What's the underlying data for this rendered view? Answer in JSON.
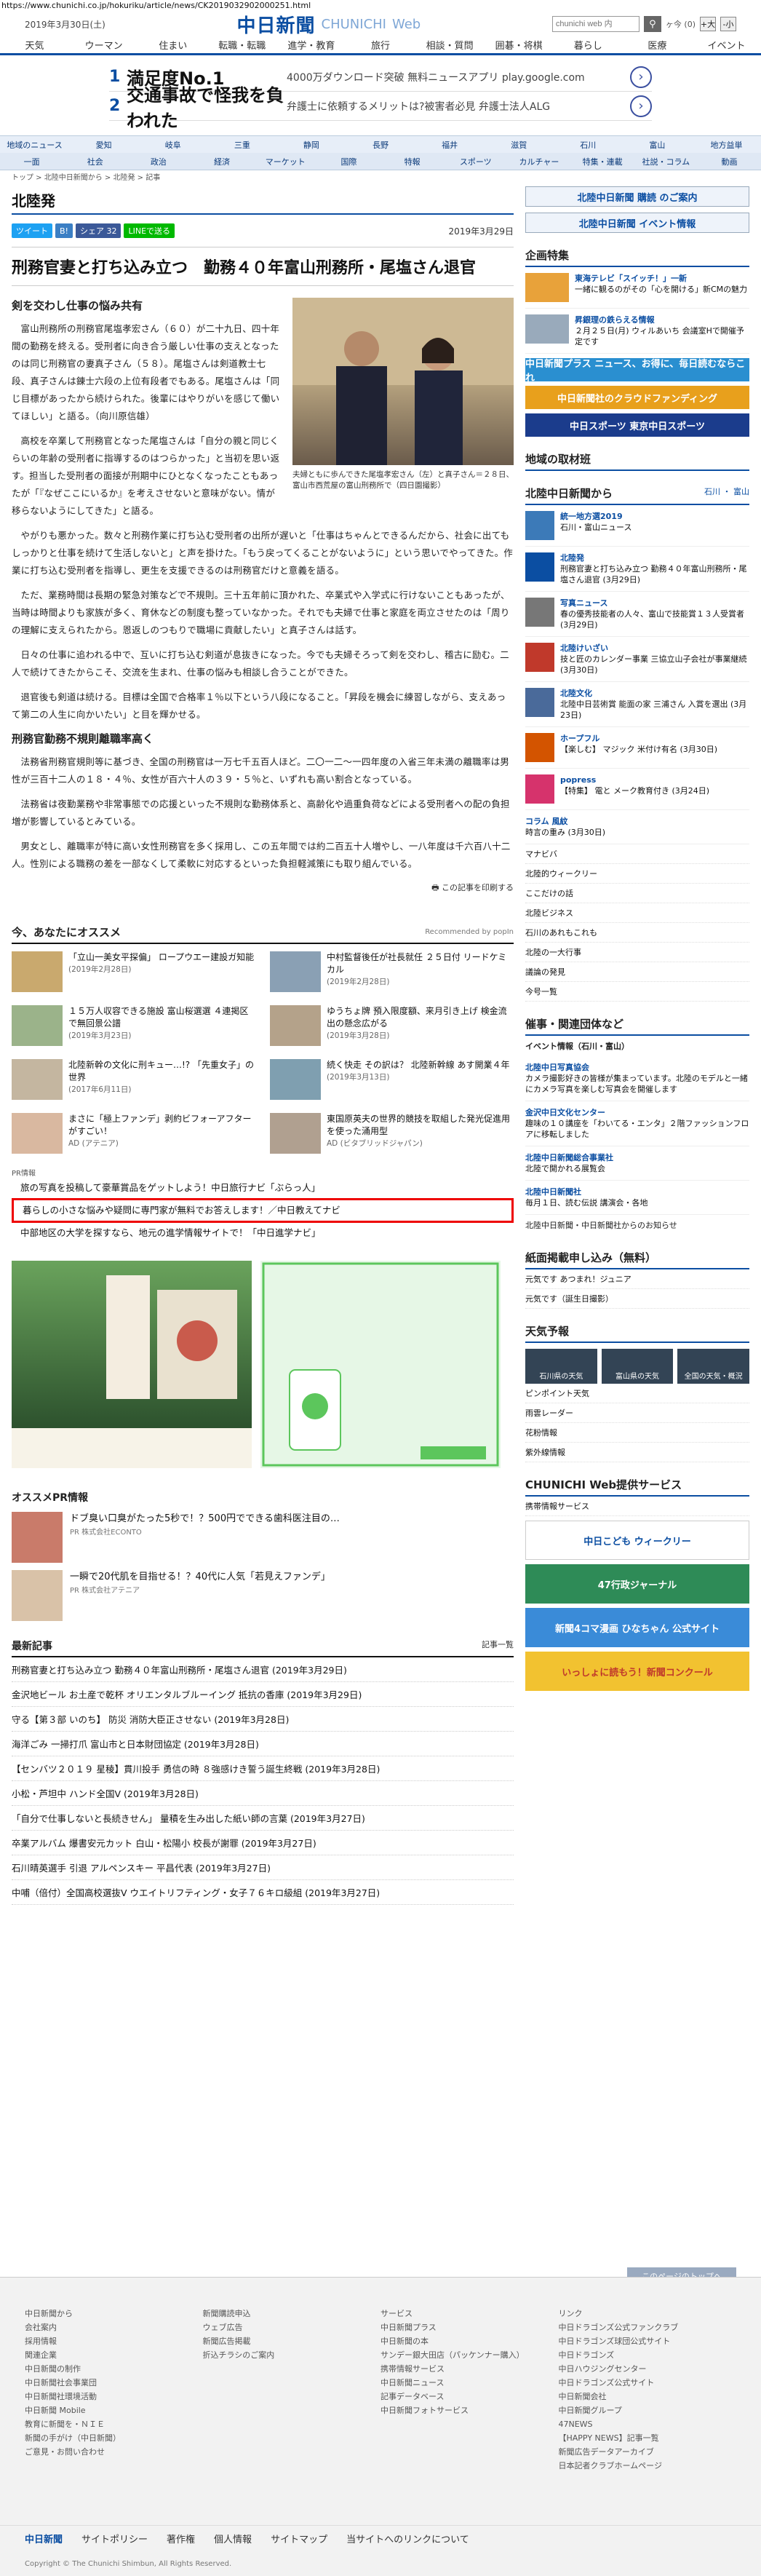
{
  "browser": {
    "url": "https://www.chunichi.co.jp/hokuriku/article/news/CK2019032902000251.html"
  },
  "header": {
    "date": "2019年3月30日(土)",
    "logo_jp": "中日新聞",
    "logo_en": "CHUNICHI",
    "logo_web": "Web",
    "search_placeholder": "chunichi web 内",
    "counter": "ヶ今 (0)",
    "font_large": "+大",
    "font_small": "-小"
  },
  "nav": [
    "天気",
    "ウーマン",
    "住まい",
    "転職・転職",
    "進学・教育",
    "旅行",
    "相談・質問",
    "囲碁・将棋",
    "暮らし",
    "医療",
    "イベント"
  ],
  "ad": {
    "items": [
      {
        "num": "1",
        "title": "満足度No.1",
        "sub": "4000万ダウンロード突破 無料ニュースアプリ play.google.com"
      },
      {
        "num": "2",
        "title": "交通事故で怪我を負われた",
        "sub": "弁護士に依頼するメリットは?被害者必見 弁護士法人ALG"
      }
    ]
  },
  "area_nav": [
    "地域のニュース",
    "愛知",
    "岐阜",
    "三重",
    "静岡",
    "長野",
    "福井",
    "滋賀",
    "石川",
    "富山",
    "地方益単"
  ],
  "area_nav2": [
    "一面",
    "社会",
    "政治",
    "経済",
    "マーケット",
    "国際",
    "特報",
    "スポーツ",
    "カルチャー",
    "特集・連載",
    "社説・コラム",
    "動画"
  ],
  "breadcrumb": "トップ > 北陸中日新聞から > 北陸発 > 記事",
  "section": "北陸発",
  "share": {
    "tweet": "ツイート",
    "hatena": "B!",
    "share": "シェア 32",
    "line": "LINEで送る",
    "date": "2019年3月29日"
  },
  "article": {
    "headline": "刑務官妻と打ち込み立つ　勤務４０年富山刑務所・尾塩さん退官",
    "h1": "剣を交わし仕事の悩み共有",
    "caption": "夫婦ともに歩んできた尾塩孝宏さん（左）と真子さん＝２８日、富山市西荒屋の富山刑務所で（四日園撮影）",
    "paragraphs": [
      "富山刑務所の刑務官尾塩孝宏さん（６０）が二十九日、四十年間の勤務を終える。受刑者に向き合う厳しい仕事の支えとなったのは同じ刑務官の妻真子さん（５８）。尾塩さんは剣道教士七段、真子さんは錬士六段の上位有段者でもある。尾塩さんは「同じ目標があったから続けられた。後輩にはやりがいを感じて働いてほしい」と語る。（向川原信雄）",
      "高校を卒業して刑務官となった尾塩さんは「自分の親と同じくらいの年齢の受刑者に指導するのはつらかった」と当初を思い返す。担当した受刑者の面接が刑期中にひとなくなったこともあったが「『なぜここにいるか』を考えさせないと意味がない。情が移らないようにしてきた」と語る。",
      "やがりも悪かった。数々と刑務作業に打ち込む受刑者の出所が遅いと「仕事はちゃんとできるんだから、社会に出てもしっかりと仕事を続けて生活しないと」と声を掛けた。「もう戻ってくることがないように」という思いでやってきた。作業に打ち込む受刑者を指導し、更生を支援できるのは刑務官だけと意義を語る。",
      "ただ、業務時間は長期の緊急対策などで不規則。三十五年前に頂かれた、卒業式や入学式に行けないこともあったが、当時は時間よりも家族が多く、育休などの制度も整っていなかった。それでも夫婦で仕事と家庭を両立させたのは「周りの理解に支えられたから。恩返しのつもりで職場に貢献したい」と真子さんは話す。",
      "日々の仕事に追われる中で、互いに打ち込む剣道が息抜きになった。今でも夫婦そろって剣を交わし、稽古に励む。二人で続けてきたからこそ、交流を生まれ、仕事の悩みも相談し合うことができた。",
      "退官後も剣道は続ける。目標は全国で合格率１％以下という八段になること。「昇段を機会に練習しながら、支えあって第二の人生に向かいたい」と目を輝かせる。"
    ],
    "h2": "刑務官勤務不規則離職率高く",
    "paragraphs2": [
      "法務省刑務官規則等に基づき、全国の刑務官は一万七千五百人ほど。二〇一二〜一四年度の入省三年未満の離職率は男性が三百十二人の１８・４％、女性が百六十人の３９・５％と、いずれも高い割合となっている。",
      "法務省は夜勤業務や非常事態での応援といった不規則な勤務体系と、高齢化や過重負荷などによる受刑者への配の負担増が影響しているとみている。",
      "男女とし、離職率が特に高い女性刑務官を多く採用し、この五年間では約二百五十人増やし、一八年度は千六百八十二人。性別による職務の差を一部なくして柔軟に対応するといった負担軽減策にも取り組んでいる。"
    ],
    "print": "この記事を印刷する"
  },
  "recommend": {
    "title": "今、あなたにオススメ",
    "by": "Recommended by popIn",
    "items": [
      {
        "title": "「立山一美女平探偏」 ロープウエー建設ガ知能",
        "date": "(2019年2月28日)"
      },
      {
        "title": "中村監督後任が社長就任 ２５日付 リードケミカル",
        "date": "(2019年2月28日)"
      },
      {
        "title": "１５万人収容できる施設 富山桜選選 ４連掲区で無回景公譜",
        "date": "(2019年3月23日)"
      },
      {
        "title": "ゆうちょ牌 預入限度額、来月引き上げ 検金流出の懸念広がる",
        "date": "(2019年3月28日)"
      },
      {
        "title": "北陸新幹の文化に刑キュー…!? 「先重女子」の世界",
        "date": "(2017年6月11日)"
      },
      {
        "title": "続く快走 その訳は？ 北陸新幹線 あす開業４年",
        "date": "(2019年3月13日)"
      },
      {
        "title": "まさに「極上ファンデ」剥約ビフォーアフターがすごい！",
        "date": "AD (アテニア)"
      },
      {
        "title": "東国原英夫の世界的競技を取組した発光促進用を使った涌用型",
        "date": "AD (ビタブリッドジャパン)"
      }
    ]
  },
  "pr": {
    "label": "PR情報",
    "lines": [
      "旅の写真を投稿して豪華賞品をゲットしよう！中日旅行ナビ「ぶらっ人」",
      "暮らしの小さな悩みや疑問に専門家が無料でお答えします！／中日教えてナビ",
      "中部地区の大学を探すなら、地元の進学情報サイトで！「中日進学ナビ」"
    ]
  },
  "osusume": {
    "title": "オススメPR情報",
    "items": [
      {
        "title": "ドブ臭い口臭がたった5秒で！？500円でできる歯科医注目の…",
        "src": "PR 株式会社ECONTO"
      },
      {
        "title": "一瞬で20代肌を目指せる！？40代に人気「若見えファンデ」",
        "src": "PR 株式会社アテニア"
      }
    ]
  },
  "latest": {
    "title": "最新記事",
    "more": "記事一覧",
    "items": [
      "刑務官妻と打ち込み立つ 勤務４０年富山刑務所・尾塩さん退官 (2019年3月29日)",
      "金沢地ビール お土産で乾杯 オリエンタルブルーイング 抵抗の香庫 (2019年3月29日)",
      "守る【第３部 いのち】 防災 消防大臣正させない (2019年3月28日)",
      "海洋ごみ 一掃打爪 富山市と日本財団協定 (2019年3月28日)",
      "【センバツ２０１９ 星稜】貫川投手 勇信の時 ８強感けき誓う誕生終戦 (2019年3月28日)",
      "小松・芦坦中 ハンド全国V (2019年3月28日)",
      "「自分で仕事しないと長続きせん」 量積を生み出した紙い師の言葉 (2019年3月27日)",
      "卒業アルバム 爆書安元カット 白山・松陽小 校長が謝罪 (2019年3月27日)",
      "石川晴英選手 引退 アルペンスキー 平昌代表 (2019年3月27日)",
      "中哺（倍付）全国高校選抜V ウエイトリフティング・女子７６キロ級組 (2019年3月27日)"
    ]
  },
  "sidebar": {
    "subscribe": "北陸中日新聞 購読 のご案内",
    "event": "北陸中日新聞 イベント情報",
    "kikaku": "企画特集",
    "kikaku_items": [
      {
        "title": "東海テレビ「スイッチ！」一新",
        "desc": "一緒に観るのがその「心を開ける」新CMの魅力"
      },
      {
        "title": "昇銀理の鉄らえる情報",
        "desc": "２月２５日(月) ウィルあいち 会議室Hで開催予定です"
      }
    ],
    "banners": [
      "中日新聞プラス ニュース、お得に、毎日読むならこれ",
      "中日新聞社のクラウドファンディング",
      "中日スポーツ 東京中日スポーツ"
    ],
    "chiiki": "地域の取材班",
    "kara": "北陸中日新聞から",
    "kara_loc": "石川 ・ 富山",
    "kara_items": [
      {
        "title": "統一地方選2019",
        "desc": "石川・富山ニュース"
      },
      {
        "title": "北陸発",
        "desc": "刑務官妻と打ち込み立つ 勤務４０年富山刑務所・尾塩さん退官 (3月29日)"
      },
      {
        "title": "写真ニュース",
        "desc": "春の優秀技能者の人々、富山で技能賞１３人受賞者 (3月29日)"
      },
      {
        "title": "北陸けいざい",
        "desc": "技と匠のカレンダー事業 三協立山子会社が事業継続 (3月30日)"
      },
      {
        "title": "北陸文化",
        "desc": "北陸中日芸術賞 能面の家 三浦さん 入賞を選出 (3月23日)"
      },
      {
        "title": "ホープフル",
        "desc": "【楽しむ】 マジック 米付け有名 (3月30日)"
      },
      {
        "title": "popress",
        "desc": "【特集】 電と メーク教育付き (3月24日)"
      }
    ],
    "column": {
      "label": "コラム 風紋",
      "desc": "時言の重み (3月30日)"
    },
    "links": [
      "マナビバ",
      "北陸的ウィークリー",
      "ここだけの話",
      "北陸ビジネス",
      "石川のあれもこれも",
      "北陸の一大行事",
      "議論の発見",
      "今号一覧"
    ],
    "saiji": "催事・関連団体など",
    "event_title": "イベント情報（石川・富山）",
    "saiji_items": [
      {
        "title": "北陸中日写真協会",
        "desc": "カメラ撮影好きの皆様が集まっています。北陸のモデルと一緒にカメラ写真を楽しむ写真会を開催します"
      },
      {
        "title": "金沢中日文化センター",
        "desc": "趣味の１０講座を「わいてる・エンタ」２階ファッションフロアに移転しました"
      },
      {
        "title": "北陸中日新聞総合事業社",
        "desc": "北陸で開かれる展覧会"
      },
      {
        "title": "北陸中日新聞社",
        "desc": "毎月１日、読む伝説 講演会・各地"
      }
    ],
    "kengai": "北陸中日新聞・中日新聞社からのお知らせ",
    "shimen": "紙面掲載申し込み（無料）",
    "shimen_items": [
      "元気です あつまれ！ジュニア",
      "元気です（誕生日撮影）"
    ],
    "weather": "天気予報",
    "weather_items": [
      "石川県の天気",
      "富山県の天気",
      "全国の天気・概況"
    ],
    "weather_links": [
      "ピンポイント天気",
      "雨雲レーダー",
      "花粉情報",
      "紫外線情報"
    ],
    "service": "CHUNICHI Web提供サービス",
    "service_link": "携帯情報サービス",
    "sbanners": [
      "中日こども ウィークリー",
      "47行政ジャーナル",
      "新聞4コマ漫画 ひなちゃん 公式サイト",
      "いっしょに読もう！新聞コンクール"
    ]
  },
  "totop": "このページのトップへ",
  "footer": {
    "cols": [
      [
        "中日新聞から",
        "会社案内",
        "採用情報",
        "関連企業",
        "中日新聞の制作",
        "中日新聞社会事業団",
        "中日新聞社環境活動",
        "中日新聞 Mobile",
        "教育に新聞を・ＮＩＥ",
        "新聞の手がけ（中日新聞）",
        "ご意見・お問い合わせ"
      ],
      [
        "新聞購読申込",
        "ウェブ広告",
        "新聞広告掲載",
        "折込チラシのご案内"
      ],
      [
        "サービス",
        "中日新聞プラス",
        "中日新聞の本",
        "サンデー銀大田店（パッケンナー購入）",
        "携帯情報サービス",
        "中日新聞ニュース",
        "記事データベース",
        "中日新聞フォトサービス"
      ],
      [
        "リンク",
        "中日ドラゴンズ公式ファンクラブ",
        "中日ドラゴンズ球団公式サイト",
        "中日ドラゴンズ",
        "中日ハウジングセンター",
        "中日ドラゴンズ公式サイト",
        "中日新聞会社",
        "中日新聞グループ",
        "47NEWS",
        "【HAPPY NEWS】記事一覧",
        "新聞広告データアーカイブ",
        "日本記者クラブホームページ"
      ]
    ],
    "bottom": [
      "中日新聞",
      "サイトポリシー",
      "著作権",
      "個人情報",
      "サイトマップ",
      "当サイトへのリンクについて"
    ],
    "copyright": "Copyright © The Chunichi Shimbun, All Rights Reserved."
  }
}
